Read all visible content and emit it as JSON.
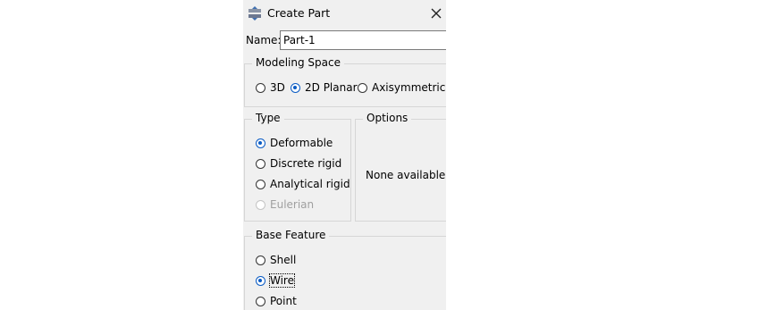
{
  "dialog": {
    "title": "Create Part",
    "name_label": "Name:",
    "name_value": "Part-1",
    "modeling_space": {
      "legend": "Modeling Space",
      "options": [
        {
          "label": "3D",
          "selected": false
        },
        {
          "label": "2D Planar",
          "selected": true
        },
        {
          "label": "Axisymmetric",
          "selected": false
        }
      ]
    },
    "type": {
      "legend": "Type",
      "options": [
        {
          "label": "Deformable",
          "selected": true,
          "enabled": true
        },
        {
          "label": "Discrete rigid",
          "selected": false,
          "enabled": true
        },
        {
          "label": "Analytical rigid",
          "selected": false,
          "enabled": true
        },
        {
          "label": "Eulerian",
          "selected": false,
          "enabled": false
        }
      ]
    },
    "options_group": {
      "legend": "Options",
      "message": "None available"
    },
    "base_feature": {
      "legend": "Base Feature",
      "options": [
        {
          "label": "Shell",
          "selected": false
        },
        {
          "label": "Wire",
          "selected": true
        },
        {
          "label": "Point",
          "selected": false
        }
      ]
    }
  },
  "colors": {
    "accent": "#0a5bc4",
    "background": "#f0f0f0",
    "disabled_text": "#a0a0a0"
  }
}
